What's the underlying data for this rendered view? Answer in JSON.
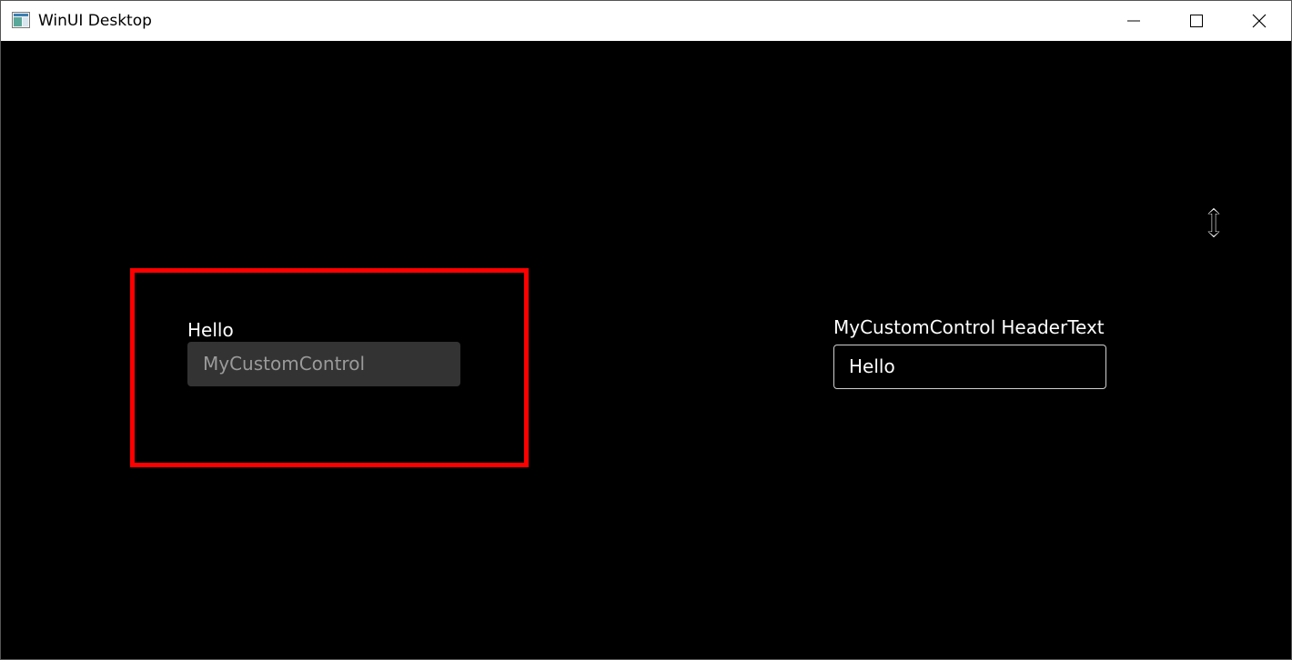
{
  "window": {
    "title": "WinUI Desktop",
    "icon": "app-window-icon",
    "caption_buttons": [
      "minimize-icon",
      "maximize-icon",
      "close-icon"
    ]
  },
  "left_control": {
    "header": "Hello",
    "placeholder": "MyCustomControl",
    "highlight_color": "#ff0000"
  },
  "right_control": {
    "header": "MyCustomControl HeaderText",
    "value": "Hello"
  },
  "cursor": {
    "icon": "resize-vertical-cursor-icon"
  }
}
